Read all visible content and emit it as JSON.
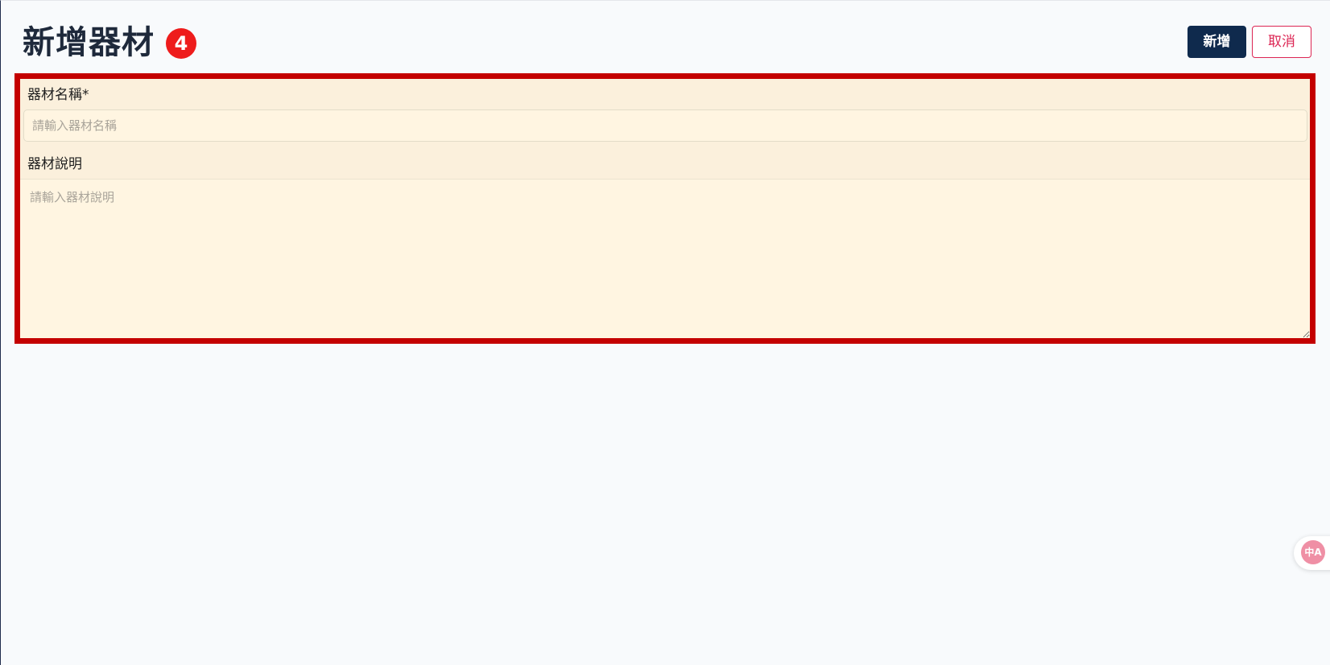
{
  "header": {
    "title": "新增器材",
    "step_badge": "4",
    "add_button_label": "新增",
    "cancel_button_label": "取消"
  },
  "form": {
    "name_field": {
      "label": "器材名稱*",
      "placeholder": "請輸入器材名稱",
      "value": ""
    },
    "description_field": {
      "label": "器材說明",
      "placeholder": "請輸入器材說明",
      "value": ""
    }
  },
  "translate_widget": {
    "icon": "translate-icon",
    "glyph": "中A"
  },
  "colors": {
    "primary": "#0f2a4d",
    "cancel": "#dc2654",
    "highlight_border": "#c40000",
    "badge": "#ee1c1c",
    "form_background": "#fbf0dc"
  }
}
